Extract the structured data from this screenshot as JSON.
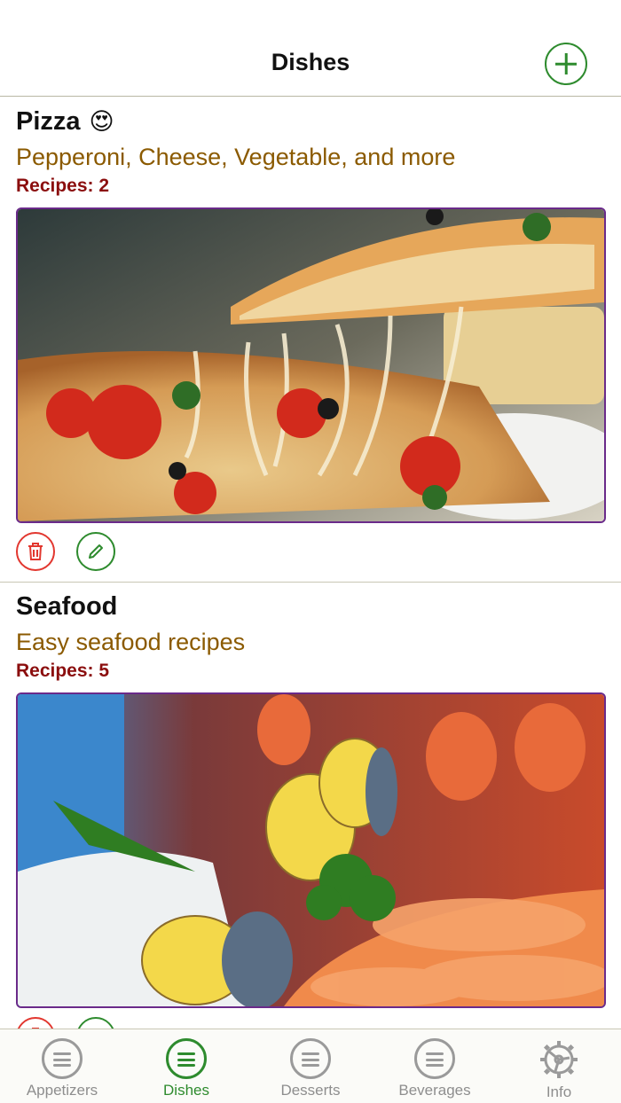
{
  "nav": {
    "title": "Dishes"
  },
  "dishes": [
    {
      "name": "Pizza",
      "emoji": "😍",
      "description": "Pepperoni, Cheese, Vegetable, and more",
      "recipes": "Recipes: 2",
      "image": "pizza-photo"
    },
    {
      "name": "Seafood",
      "emoji": "",
      "description": "Easy seafood recipes",
      "recipes": "Recipes: 5",
      "image": "seafood-photo"
    }
  ],
  "tabs": [
    {
      "label": "Appetizers",
      "icon": "list-icon",
      "active": false
    },
    {
      "label": "Dishes",
      "icon": "list-icon",
      "active": true
    },
    {
      "label": "Desserts",
      "icon": "list-icon",
      "active": false
    },
    {
      "label": "Beverages",
      "icon": "list-icon",
      "active": false
    },
    {
      "label": "Info",
      "icon": "gear-icon",
      "active": false
    }
  ],
  "colors": {
    "accent": "#2e8b2e",
    "delete": "#e2372f",
    "description": "#8b5a00",
    "count": "#8b0e0e",
    "image_border": "#6a2a8a"
  }
}
